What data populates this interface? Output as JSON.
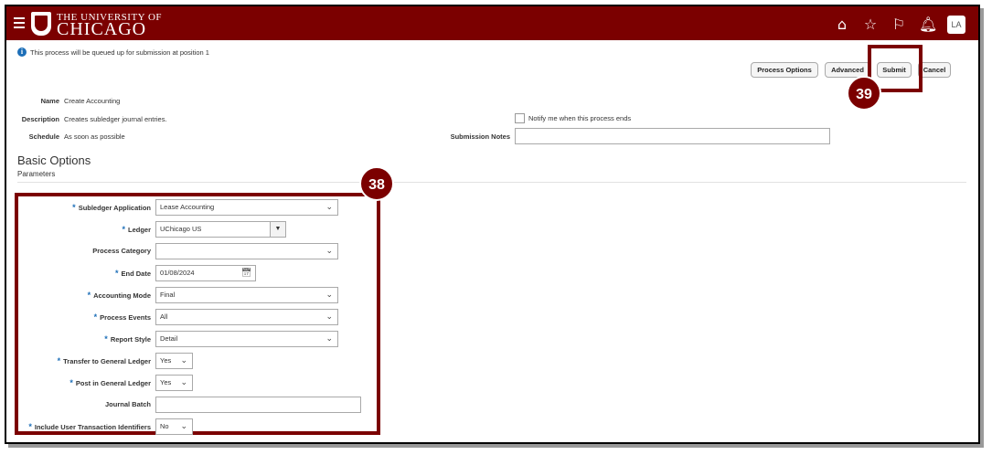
{
  "header": {
    "brand_top": "THE UNIVERSITY OF",
    "brand_main": "CHICAGO",
    "icons": [
      "menu-icon",
      "home-icon",
      "star-icon",
      "flag-icon",
      "bell-icon"
    ],
    "avatar": "LA",
    "color": "#7b0000"
  },
  "info_message": "This process will be queued up for submission at position 1",
  "toolbar": {
    "process_options": "Process Options",
    "advanced": "Advanced",
    "submit": "Submit",
    "cancel": "Cancel"
  },
  "callouts": {
    "submit": "39",
    "parameters": "38"
  },
  "details": {
    "name_label": "Name",
    "name_value": "Create Accounting",
    "description_label": "Description",
    "description_value": "Creates subledger journal entries.",
    "schedule_label": "Schedule",
    "schedule_value": "As soon as possible",
    "notify_label": "Notify me when this process ends",
    "submission_notes_label": "Submission Notes",
    "submission_notes_value": ""
  },
  "section": {
    "title": "Basic Options",
    "subtitle": "Parameters"
  },
  "parameters": {
    "subledger_application": {
      "label": "Subledger Application",
      "value": "Lease Accounting"
    },
    "ledger": {
      "label": "Ledger",
      "value": "UChicago US"
    },
    "process_category": {
      "label": "Process Category",
      "value": ""
    },
    "end_date": {
      "label": "End Date",
      "value": "01/08/2024"
    },
    "accounting_mode": {
      "label": "Accounting Mode",
      "value": "Final"
    },
    "process_events": {
      "label": "Process Events",
      "value": "All"
    },
    "report_style": {
      "label": "Report Style",
      "value": "Detail"
    },
    "transfer_to_gl": {
      "label": "Transfer to General Ledger",
      "value": "Yes"
    },
    "post_in_gl": {
      "label": "Post in General Ledger",
      "value": "Yes"
    },
    "journal_batch": {
      "label": "Journal Batch",
      "value": ""
    },
    "include_user_txn_ids": {
      "label": "Include User Transaction Identifiers",
      "value": "No"
    }
  }
}
